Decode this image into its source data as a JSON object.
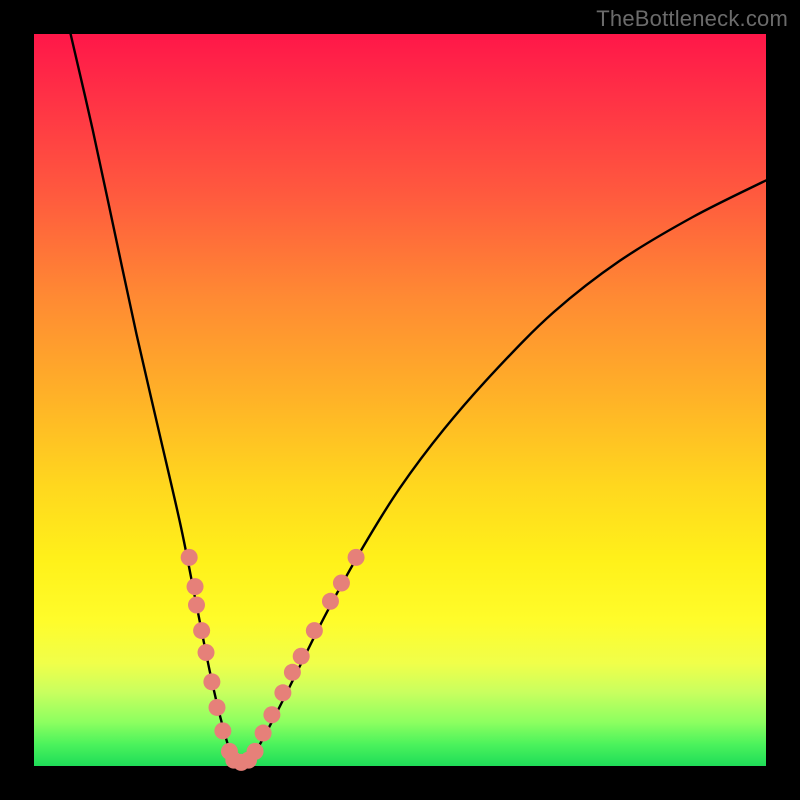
{
  "watermark": "TheBottleneck.com",
  "chart_data": {
    "type": "line",
    "title": "",
    "xlabel": "",
    "ylabel": "",
    "xlim": [
      0,
      100
    ],
    "ylim": [
      0,
      100
    ],
    "grid": false,
    "series": [
      {
        "name": "bottleneck-curve",
        "x": [
          5,
          8,
          11,
          14,
          17,
          20,
          22,
          24,
          25.5,
          27,
          28.5,
          30,
          33,
          36,
          40,
          45,
          50,
          56,
          63,
          71,
          80,
          90,
          100
        ],
        "y": [
          100,
          87,
          73,
          59,
          46,
          33,
          23,
          13,
          6.5,
          1.5,
          0.3,
          1.5,
          7,
          13,
          21,
          30,
          38,
          46,
          54,
          62,
          69,
          75,
          80
        ]
      }
    ],
    "highlight_points": {
      "name": "marked-points",
      "color": "#e68079",
      "points": [
        {
          "x": 21.2,
          "y": 28.5
        },
        {
          "x": 22.0,
          "y": 24.5
        },
        {
          "x": 22.2,
          "y": 22.0
        },
        {
          "x": 22.9,
          "y": 18.5
        },
        {
          "x": 23.5,
          "y": 15.5
        },
        {
          "x": 24.3,
          "y": 11.5
        },
        {
          "x": 25.0,
          "y": 8.0
        },
        {
          "x": 25.8,
          "y": 4.8
        },
        {
          "x": 26.7,
          "y": 2.0
        },
        {
          "x": 27.3,
          "y": 0.8
        },
        {
          "x": 28.3,
          "y": 0.5
        },
        {
          "x": 29.3,
          "y": 0.8
        },
        {
          "x": 30.2,
          "y": 2.0
        },
        {
          "x": 31.3,
          "y": 4.5
        },
        {
          "x": 32.5,
          "y": 7.0
        },
        {
          "x": 34.0,
          "y": 10.0
        },
        {
          "x": 35.3,
          "y": 12.8
        },
        {
          "x": 36.5,
          "y": 15.0
        },
        {
          "x": 38.3,
          "y": 18.5
        },
        {
          "x": 40.5,
          "y": 22.5
        },
        {
          "x": 42.0,
          "y": 25.0
        },
        {
          "x": 44.0,
          "y": 28.5
        }
      ]
    },
    "background_gradient": {
      "top_color": "#ff1749",
      "bottom_color": "#1fdc58"
    }
  }
}
